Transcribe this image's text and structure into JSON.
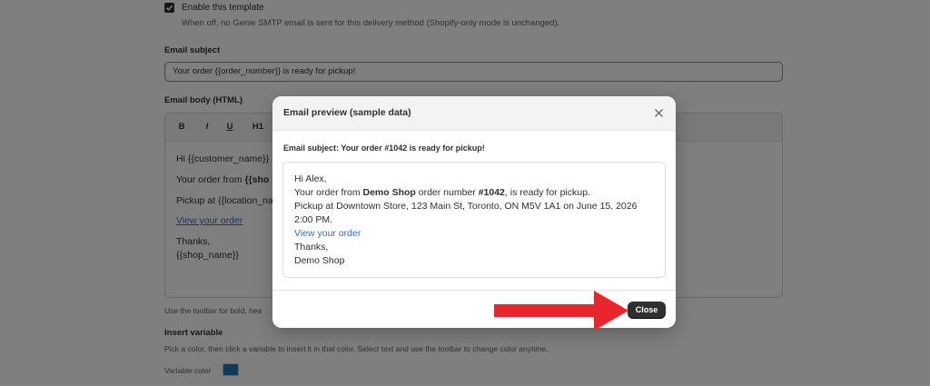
{
  "settings": {
    "enable_label": "Enable this template",
    "enable_help": "When off, no Genie SMTP email is sent for this delivery method (Shopify-only mode is unchanged).",
    "subject_label": "Email subject",
    "subject_value": "Your order {{order_number}} is ready for pickup!",
    "body_label": "Email body (HTML)",
    "toolbar": {
      "bold": "B",
      "italic": "I",
      "underline": "U",
      "h1": "H1"
    },
    "editor_lines": {
      "greeting": "Hi {{customer_name}}",
      "order_prefix": "Your order from ",
      "order_bold": "{{sho",
      "pickup": "Pickup at {{location_na",
      "link": "View your order",
      "thanks": "Thanks,",
      "shop": "{{shop_name}}"
    },
    "toolbar_help": "Use the toolbar for bold, hea",
    "insert_variable_label": "Insert variable",
    "insert_variable_help": "Pick a color, then click a variable to insert it in that color. Select text and use the toolbar to change color anytime.",
    "variable_color_label": "Variable color",
    "variable_color": "#1d76b8"
  },
  "modal": {
    "title": "Email preview (sample data)",
    "subject": "Email subject: Your order #1042 is ready for pickup!",
    "body": {
      "greeting": "Hi Alex,",
      "order_1": "Your order from ",
      "shop_bold": "Demo Shop",
      "order_2": " order number ",
      "order_number": "#1042",
      "order_3": ", is ready for pickup.",
      "pickup_1": "Pickup at Downtown Store, 123 Main St, Toronto, ON M5V 1A1 on June 15, 2026",
      "pickup_2": "2:00 PM.",
      "link": "View your order",
      "thanks": "Thanks,",
      "signoff": "Demo Shop"
    },
    "close_label": "Close"
  },
  "colors": {
    "accent_link": "#2c6ecb",
    "primary_button": "#303030",
    "annotation_arrow": "#e8262b"
  }
}
